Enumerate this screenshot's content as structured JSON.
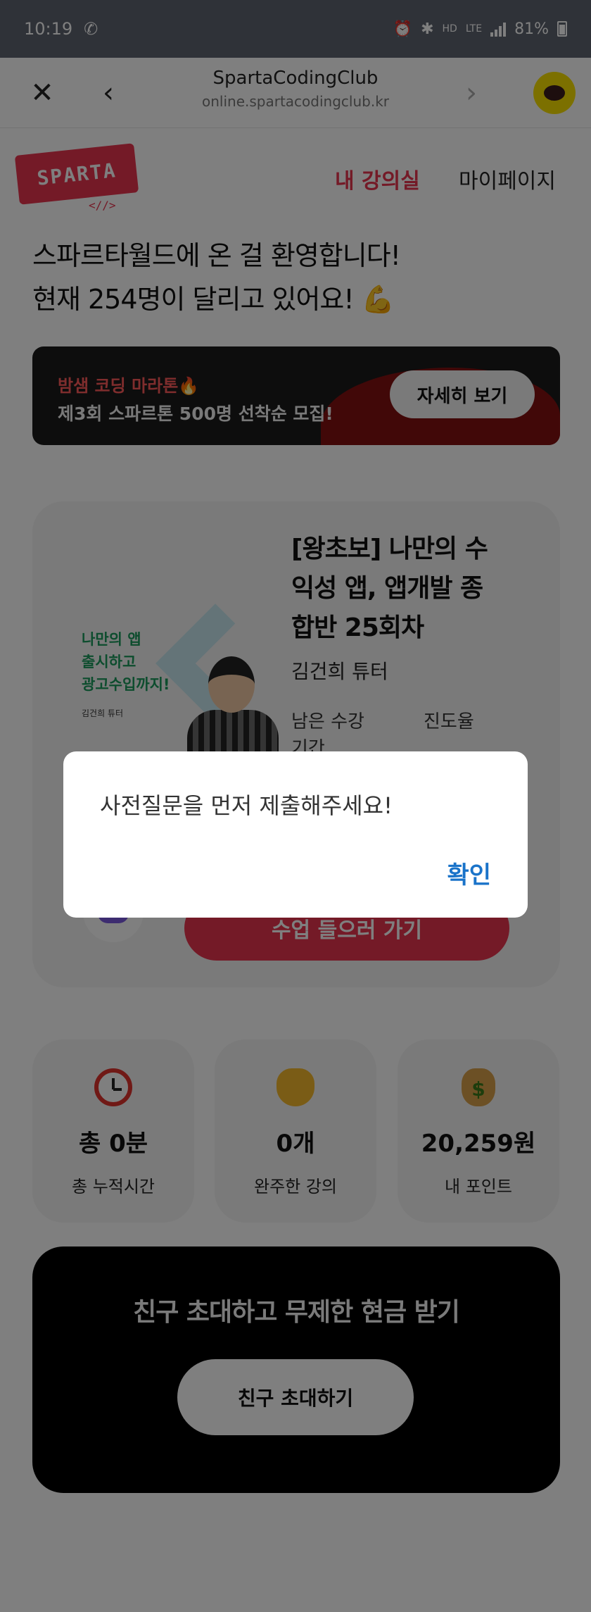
{
  "status_bar": {
    "time": "10:19",
    "battery": "81%",
    "network": "LTE"
  },
  "browser": {
    "title": "SpartaCodingClub",
    "url": "online.spartacodingclub.kr"
  },
  "header": {
    "logo": "SPARTA",
    "logo_sub": "<//>",
    "nav_active": "내 강의실",
    "nav_mypage": "마이페이지"
  },
  "welcome": {
    "line1": "스파르타월드에 온 걸 환영합니다!",
    "line2": "현재 254명이 달리고 있어요! 💪"
  },
  "banner": {
    "line1": "밤샘 코딩 마라톤🔥",
    "line2": "제3회 스파르톤 500명 선착순 모집!",
    "button": "자세히 보기"
  },
  "course": {
    "thumb_text_1": "나만의 앱",
    "thumb_text_2": "출시하고",
    "thumb_text_3": "광고수입까지!",
    "thumb_tutor": "김건희 튜터",
    "title": "[왕초보] 나만의 수익성 앱, 앱개발 종합반 25회차",
    "tutor": "김건희 튜터",
    "meta_remaining": "남은 수강",
    "meta_progress": "진도율",
    "meta_period": "기간",
    "continue_button": "수업 들으러 가기"
  },
  "stats": [
    {
      "icon": "alarm-clock-icon",
      "value": "총 0분",
      "label": "총 누적시간"
    },
    {
      "icon": "clapping-hands-icon",
      "value": "0개",
      "label": "완주한 강의"
    },
    {
      "icon": "money-bag-icon",
      "value": "20,259원",
      "label": "내 포인트"
    }
  ],
  "invite": {
    "title": "친구 초대하고 무제한 현금 받기",
    "button": "친구 초대하기"
  },
  "dialog": {
    "message": "사전질문을 먼저 제출해주세요!",
    "confirm": "확인"
  }
}
